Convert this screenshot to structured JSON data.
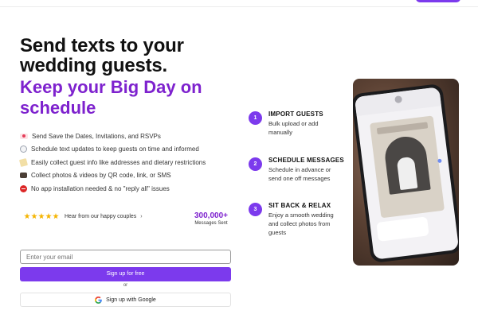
{
  "hero": {
    "headline_line1": "Send texts to your",
    "headline_line2": "wedding guests.",
    "subheadline_line1": "Keep your Big Day on",
    "subheadline_line2": "schedule"
  },
  "features": [
    {
      "icon": "love-letter-icon",
      "color": "#e53e5a",
      "text": "Send Save the Dates, Invitations, and RSVPs"
    },
    {
      "icon": "clock-icon",
      "color": "#9ca3af",
      "text": "Schedule text updates to keep guests on time and informed"
    },
    {
      "icon": "memo-icon",
      "color": "#d4a94a",
      "text": "Easily collect guest info like addresses and dietary restrictions"
    },
    {
      "icon": "camera-icon",
      "color": "#6b5a4a",
      "text": "Collect photos & videos by QR code, link, or SMS"
    },
    {
      "icon": "no-entry-icon",
      "color": "#dc2626",
      "text": "No app installation needed & no \"reply all\" issues"
    }
  ],
  "social": {
    "stars": 5,
    "text": "Hear from our happy couples",
    "chevron": "›"
  },
  "stat": {
    "number": "300,000+",
    "label": "Messages Sent"
  },
  "signup": {
    "email_placeholder": "Enter your email",
    "button_label": "Sign up for free",
    "or_text": "or",
    "google_label": "Sign up with Google"
  },
  "steps": [
    {
      "number": "1",
      "title": "IMPORT GUESTS",
      "desc_lines": [
        "Bulk upload or add",
        "manually"
      ]
    },
    {
      "number": "2",
      "title": "SCHEDULE MESSAGES",
      "desc_lines": [
        "Schedule in advance or",
        "send one off messages"
      ]
    },
    {
      "number": "3",
      "title": "SIT BACK & RELAX",
      "desc_lines": [
        "Enjoy a smooth wedding",
        "and collect photos from",
        "guests"
      ]
    }
  ],
  "colors": {
    "accent": "#7c3aed",
    "headline_purple": "#7e22ce"
  }
}
